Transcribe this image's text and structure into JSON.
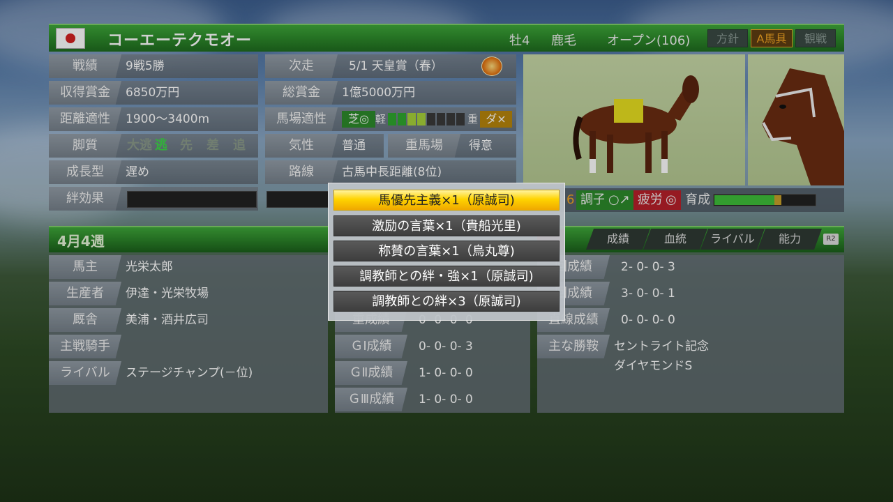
{
  "header": {
    "horse_name": "コーエーテクモオー",
    "sex_age": "牡4",
    "coat": "鹿毛",
    "class": "オープン(106)",
    "buttons": {
      "policy": "方針",
      "gear": "A馬具",
      "watch": "観戦"
    }
  },
  "profile": {
    "record_label": "戦績",
    "record": "9戦5勝",
    "earnings_label": "収得賞金",
    "earnings": "6850万円",
    "distance_label": "距離適性",
    "distance": "1900〜3400m",
    "style_label": "脚質",
    "running_styles": [
      "大逃",
      "逃",
      "先",
      "差",
      "追"
    ],
    "growth_label": "成長型",
    "growth": "遅め",
    "bond_label": "絆効果",
    "next_label": "次走",
    "next_race": "5/1 天皇賞（春）",
    "total_label": "総賞金",
    "total": "1億5000万円",
    "track_label": "馬場適性",
    "turf": "芝◎",
    "light": "軽",
    "heavy": "重",
    "dirt": "ダ×",
    "temper_label": "気性",
    "temper": "普通",
    "muddy_label": "重馬場",
    "muddy": "得意",
    "route_label": "路線",
    "route": "古馬中長距離(8位)"
  },
  "status": {
    "num": "6",
    "condition_label": "調子",
    "condition": "○↗",
    "fatigue_label": "疲労",
    "fatigue": "◎",
    "training_label": "育成",
    "training_level": 0.7
  },
  "week": "4月4週",
  "owner": {
    "owner_label": "馬主",
    "owner": "光栄太郎",
    "breeder_label": "生産者",
    "breeder": "伊達・光栄牧場",
    "stable_label": "厩舎",
    "stable": "美浦・酒井広司",
    "jockey_label": "主戦騎手",
    "jockey": "",
    "rival_label": "ライバル",
    "rival": "ステージチャンプ(－位)"
  },
  "grades": {
    "mid_row_label": "重成績",
    "mid_row": "0- 0- 0- 0",
    "g1_label": "ＧⅠ成績",
    "g1": "0- 0- 0- 3",
    "g2_label": "ＧⅡ成績",
    "g2": "1- 0- 0- 0",
    "g3_label": "ＧⅢ成績",
    "g3": "1- 0- 0- 0"
  },
  "tabs": [
    "成績",
    "血統",
    "ライバル",
    "能力"
  ],
  "r2": "R2",
  "results": {
    "r1_label": "回成績",
    "r1": "2- 0- 0- 3",
    "r2_label": "回成績",
    "r2": "3- 0- 0- 1",
    "r3_label": "直線成績",
    "r3": "0- 0- 0- 0",
    "wins_label": "主な勝鞍",
    "wins": [
      "セントライト記念",
      "ダイヤモンドS"
    ]
  },
  "popup": {
    "items": [
      "馬優先主義×1（原誠司)",
      "激励の言葉×1（貴船光里)",
      "称賛の言葉×1（烏丸尊)",
      "調教師との絆・強×1（原誠司)",
      "調教師との絆×3（原誠司)"
    ]
  },
  "colors": {
    "accent_green": "#2d8a2b",
    "selected": "#ffd400",
    "gear": "#f5a623"
  }
}
